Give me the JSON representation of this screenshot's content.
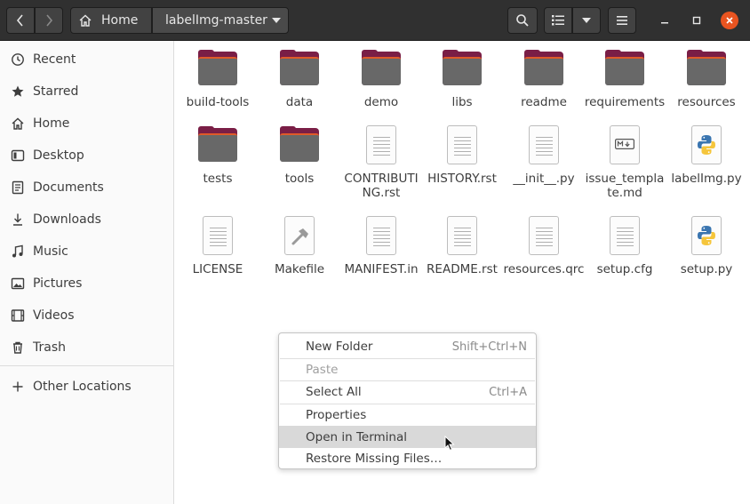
{
  "header": {
    "back_icon": "chevron-left-icon",
    "forward_icon": "chevron-right-icon",
    "home_label": "Home",
    "current_folder": "labelImg-master",
    "window_controls": [
      "minimize",
      "maximize",
      "close"
    ],
    "accent_color": "#e95420"
  },
  "sidebar": {
    "items": [
      {
        "label": "Recent",
        "icon": "clock-icon"
      },
      {
        "label": "Starred",
        "icon": "star-icon"
      },
      {
        "label": "Home",
        "icon": "home-icon"
      },
      {
        "label": "Desktop",
        "icon": "desktop-icon"
      },
      {
        "label": "Documents",
        "icon": "documents-icon"
      },
      {
        "label": "Downloads",
        "icon": "download-icon"
      },
      {
        "label": "Music",
        "icon": "music-icon"
      },
      {
        "label": "Pictures",
        "icon": "pictures-icon"
      },
      {
        "label": "Videos",
        "icon": "videos-icon"
      },
      {
        "label": "Trash",
        "icon": "trash-icon"
      },
      {
        "label": "Other Locations",
        "icon": "plus-icon"
      }
    ]
  },
  "files": [
    {
      "name": "build-tools",
      "kind": "folder"
    },
    {
      "name": "data",
      "kind": "folder"
    },
    {
      "name": "demo",
      "kind": "folder"
    },
    {
      "name": "libs",
      "kind": "folder"
    },
    {
      "name": "readme",
      "kind": "folder"
    },
    {
      "name": "requirements",
      "kind": "folder"
    },
    {
      "name": "resources",
      "kind": "folder"
    },
    {
      "name": "tests",
      "kind": "folder"
    },
    {
      "name": "tools",
      "kind": "folder"
    },
    {
      "name": "CONTRIBUTING.rst",
      "kind": "text"
    },
    {
      "name": "HISTORY.rst",
      "kind": "text"
    },
    {
      "name": "__init__.py",
      "kind": "text"
    },
    {
      "name": "issue_template.md",
      "kind": "markdown"
    },
    {
      "name": "labelImg.py",
      "kind": "python"
    },
    {
      "name": "LICENSE",
      "kind": "text"
    },
    {
      "name": "Makefile",
      "kind": "makefile"
    },
    {
      "name": "MANIFEST.in",
      "kind": "text"
    },
    {
      "name": "README.rst",
      "kind": "text"
    },
    {
      "name": "resources.qrc",
      "kind": "text"
    },
    {
      "name": "setup.cfg",
      "kind": "text"
    },
    {
      "name": "setup.py",
      "kind": "python"
    }
  ],
  "context_menu": {
    "items": [
      {
        "label": "New Folder",
        "shortcut": "Shift+Ctrl+N",
        "disabled": false
      },
      {
        "label": "Paste",
        "shortcut": "",
        "disabled": true
      },
      {
        "label": "Select All",
        "shortcut": "Ctrl+A",
        "disabled": false
      },
      {
        "label": "Properties",
        "shortcut": "",
        "disabled": false
      },
      {
        "label": "Open in Terminal",
        "shortcut": "",
        "disabled": false,
        "highlighted": true
      },
      {
        "label": "Restore Missing Files…",
        "shortcut": "",
        "disabled": false
      }
    ]
  }
}
